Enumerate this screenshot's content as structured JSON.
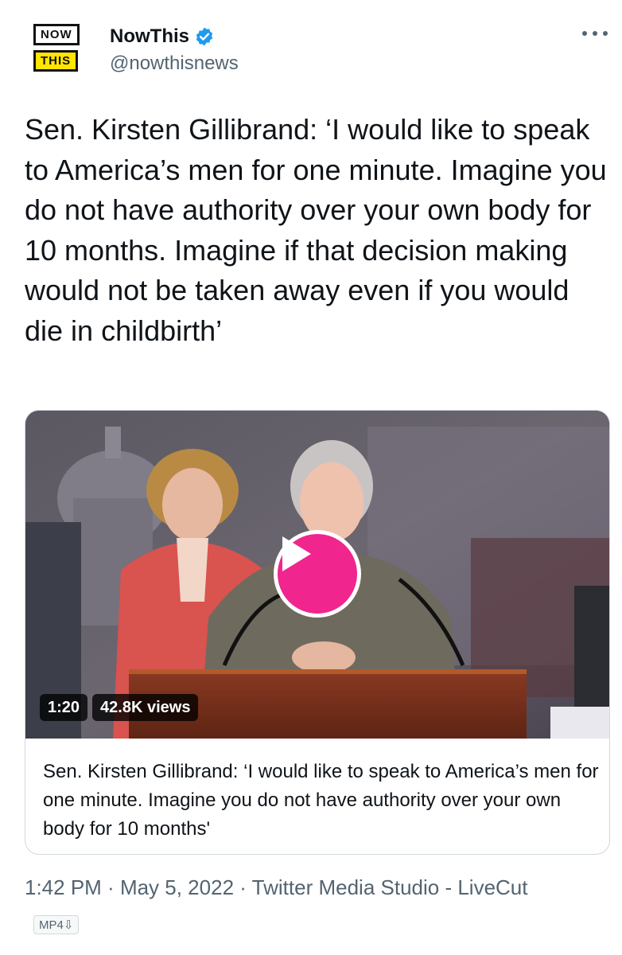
{
  "author": {
    "logo_line1": "NOW",
    "logo_line2": "THIS",
    "display_name": "NowThis",
    "handle": "@nowthisnews",
    "verified": true
  },
  "tweet": {
    "text": "Sen. Kirsten Gillibrand: ‘I would like to speak to America’s men for one minute. Imagine you do not have authority over your own body for 10 months. Imagine if that decision making would not be taken away even if you would die in childbirth’"
  },
  "video": {
    "duration": "1:20",
    "views": "42.8K views",
    "caption": "Sen. Kirsten Gillibrand: ‘I would like to speak to America’s men for one minute. Imagine you do not have authority over your own body for 10 months'"
  },
  "meta": {
    "time": "1:42 PM",
    "date": "May 5, 2022",
    "source": "Twitter Media Studio - LiveCut",
    "separator": " · "
  },
  "badge": "MP4⇩",
  "colors": {
    "play_button": "#f0258e",
    "verified": "#1d9bf0",
    "logo_yellow": "#ffe500"
  }
}
